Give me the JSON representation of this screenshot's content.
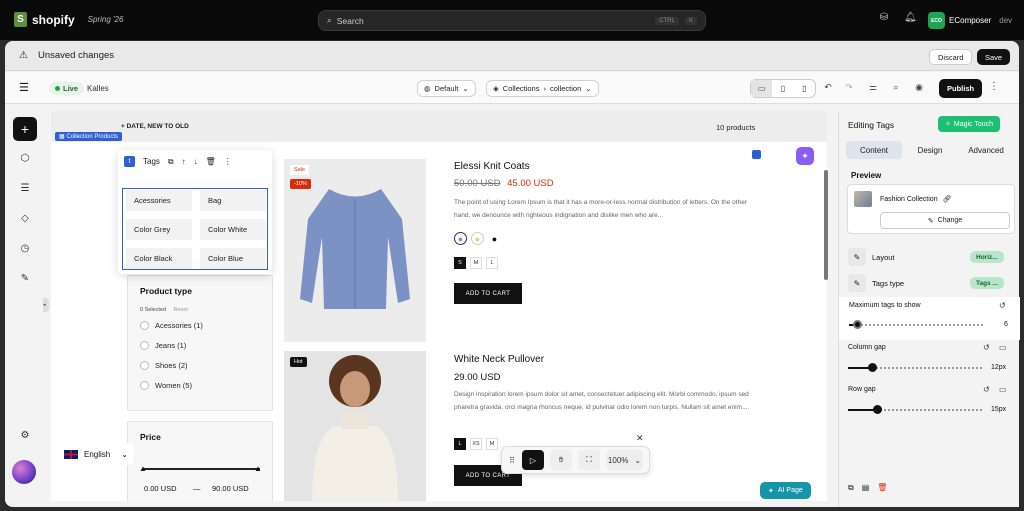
{
  "topbar": {
    "brand": "shopify",
    "edition": "Spring '26",
    "search_placeholder": "Search",
    "kbd": [
      "CTRL",
      "K"
    ],
    "user_initials": "ECO",
    "user_name": "EComposer",
    "user_env": "dev"
  },
  "unsaved": {
    "message": "Unsaved changes",
    "discard": "Discard",
    "save": "Save"
  },
  "toolbar": {
    "live": "Live",
    "store": "Kalles",
    "theme": "Default",
    "page_group": "Collections",
    "page": "collection",
    "publish": "Publish"
  },
  "canvas": {
    "section_tag": "Collection Products",
    "sort_label": "DATE, NEW TO OLD",
    "product_count": "10 products",
    "tags_toolbar_label": "Tags",
    "tags": [
      "Acessories",
      "Bag",
      "Color Grey",
      "Color White",
      "Color Black",
      "Color Blue"
    ],
    "product_type": {
      "title": "Product type",
      "selected": "0 Selected",
      "reset": "Reset",
      "options": [
        "Acessories (1)",
        "Jeans (1)",
        "Shoes (2)",
        "Women (5)"
      ]
    },
    "price": {
      "title": "Price",
      "min": "0.00 USD",
      "sep": "—",
      "max": "90.00 USD",
      "range_low_fraction": 0,
      "range_high_fraction": 1
    },
    "products": [
      {
        "badges": [
          "Sale",
          "-10%"
        ],
        "title": "Elessi Knit Coats",
        "old_price": "50.00 USD",
        "price": "45.00 USD",
        "desc": "The point of using Lorem Ipsum is that it has a more-or-less normal distribution of letters. On the other hand, we denounce with righteous indignation and dislike men who are...",
        "sizes": [
          "S",
          "M",
          "L"
        ],
        "cart": "ADD TO CART"
      },
      {
        "badges": [
          "Hot"
        ],
        "title": "White Neck Pullover",
        "price": "29.00 USD",
        "desc": "Design inspiration lorem ipsum dolor sit amet, consectetuer adipiscing elit. Morbi commodo, ipsum sed pharetra gravida, orci magna rhoncus neque, id pulvinar odio lorem non turpis. Nullam sit amet enim....",
        "sizes": [
          "L",
          "XS",
          "M"
        ],
        "cart": "ADD TO CART"
      }
    ],
    "zoom": "100%",
    "ai_page": "AI Page",
    "language": "English"
  },
  "panel": {
    "title": "Editing Tags",
    "magic": "Magic Touch",
    "tabs": [
      "Content",
      "Design",
      "Advanced"
    ],
    "preview_label": "Preview",
    "preview_item": "Fashion Collection",
    "change": "Change",
    "layout_label": "Layout",
    "layout_value": "Horiz...",
    "tags_type_label": "Tags type",
    "tags_type_value": "Tags ...",
    "max_tags_label": "Maximum tags to show",
    "max_tags_value": "6",
    "max_tags_fraction": 0.06,
    "column_gap_label": "Column gap",
    "column_gap_value": "12px",
    "column_gap_fraction": 0.18,
    "row_gap_label": "Row gap",
    "row_gap_value": "15px",
    "row_gap_fraction": 0.22
  },
  "colors": {
    "accent": "#2d5fd8",
    "sale_red": "#d72c0d",
    "live_green": "#27a148",
    "magic_green": "#1dbf73"
  }
}
